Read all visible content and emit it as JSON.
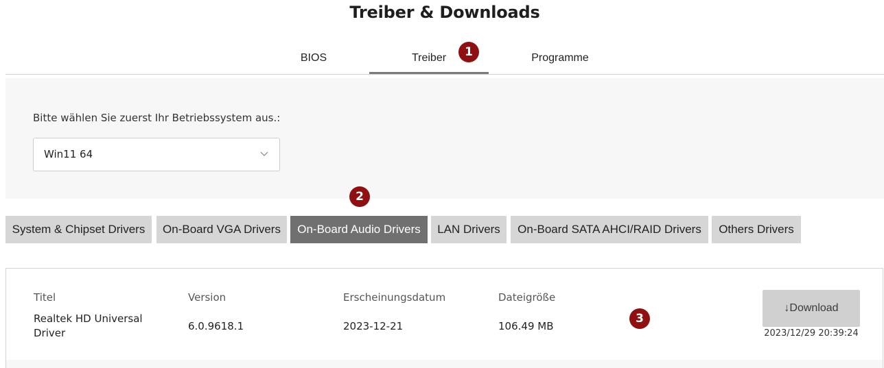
{
  "page_title": "Treiber & Downloads",
  "tabs": [
    {
      "label": "BIOS",
      "active": false
    },
    {
      "label": "Treiber",
      "active": true
    },
    {
      "label": "Programme",
      "active": false
    }
  ],
  "markers": [
    "1",
    "2",
    "3"
  ],
  "os": {
    "label": "Bitte wählen Sie zuerst Ihr Betriebssystem aus.:",
    "selected": "Win11 64"
  },
  "categories": [
    {
      "label": "System & Chipset Drivers",
      "active": false
    },
    {
      "label": "On-Board VGA Drivers",
      "active": false
    },
    {
      "label": "On-Board Audio Drivers",
      "active": true
    },
    {
      "label": "LAN Drivers",
      "active": false
    },
    {
      "label": "On-Board SATA AHCI/RAID Drivers",
      "active": false
    },
    {
      "label": "Others Drivers",
      "active": false
    }
  ],
  "driver": {
    "headers": {
      "title": "Titel",
      "version": "Version",
      "date": "Erscheinungsdatum",
      "size": "Dateigröße"
    },
    "title_line1": "Realtek HD Universal",
    "title_line2": "Driver",
    "version": "6.0.9618.1",
    "date": "2023-12-21",
    "size": "106.49 MB",
    "download_label": "↓Download",
    "timestamp": "2023/12/29 20:39:24"
  },
  "colors": {
    "marker": "#8e1010",
    "active_category": "#707070",
    "category": "#d6d6d6"
  }
}
